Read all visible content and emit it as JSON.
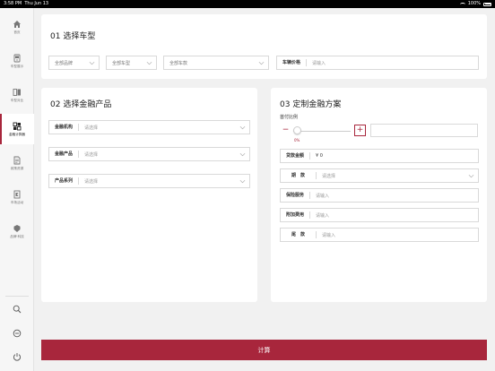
{
  "status_bar": {
    "time": "3:58 PM",
    "date": "Thu Jun 13",
    "battery": "100%"
  },
  "sidebar": {
    "items": [
      {
        "label": "首页",
        "icon": "home-icon"
      },
      {
        "label": "车型展示",
        "icon": "car-icon"
      },
      {
        "label": "车型对比",
        "icon": "compare-icon"
      },
      {
        "label": "金融计算器",
        "icon": "grid-icon",
        "active": true
      },
      {
        "label": "政策资源",
        "icon": "document-icon"
      },
      {
        "label": "市场活动",
        "icon": "flag-icon"
      },
      {
        "label": "品牌·科技",
        "icon": "shield-icon"
      }
    ],
    "tools": [
      "search-icon",
      "zoom-out-icon",
      "power-icon"
    ]
  },
  "section1": {
    "title": "01 选择车型",
    "brand_select": "全部品牌",
    "type_select": "全部车型",
    "model_select": "全部车款",
    "price_label": "车辆价格",
    "price_placeholder": "请输入"
  },
  "section2": {
    "title": "02 选择金融产品",
    "fields": [
      {
        "label": "金融机构",
        "placeholder": "请选择"
      },
      {
        "label": "金融产品",
        "placeholder": "请选择"
      },
      {
        "label": "产品系列",
        "placeholder": "请选择"
      }
    ]
  },
  "section3": {
    "title": "03 定制金融方案",
    "down_payment_label": "首付比例",
    "minus": "−",
    "plus": "+",
    "slider_value": "0%",
    "slider_fraction": 0,
    "loan_label": "贷款金额",
    "loan_value": "¥ 0",
    "term_label": "期　款",
    "term_placeholder": "请选择",
    "insurance_label": "保险服务",
    "insurance_placeholder": "请输入",
    "extra_label": "附加费用",
    "extra_placeholder": "请输入",
    "balloon_label": "尾　款",
    "balloon_placeholder": "请输入"
  },
  "calculate_label": "计算",
  "colors": {
    "accent": "#a8263c"
  }
}
